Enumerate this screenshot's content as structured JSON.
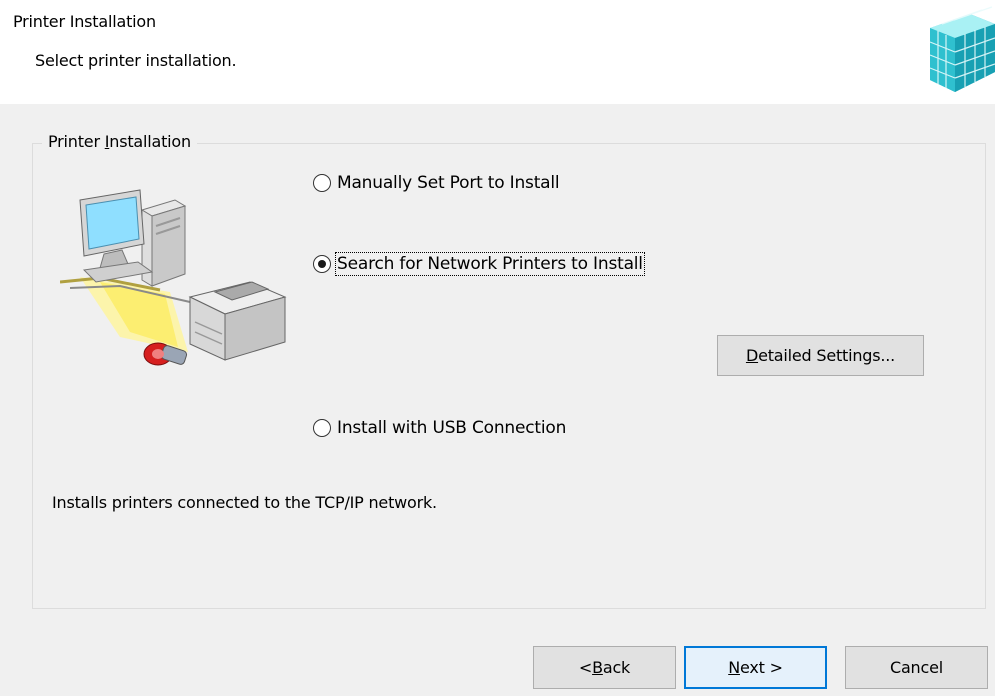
{
  "header": {
    "title": "Printer Installation",
    "subtitle": "Select printer installation."
  },
  "group": {
    "legend_pre": "Printer ",
    "legend_mnemonic": "I",
    "legend_post": "nstallation"
  },
  "options": {
    "manual": {
      "label": "Manually Set Port to Install",
      "selected": false
    },
    "network": {
      "label": "Search for Network Printers to Install",
      "selected": true
    },
    "usb": {
      "label": "Install with USB Connection",
      "selected": false
    }
  },
  "detailed_settings": {
    "mnemonic": "D",
    "rest": "etailed Settings..."
  },
  "description": "Installs printers connected to the TCP/IP network.",
  "buttons": {
    "back_pre": "< ",
    "back_mnemonic": "B",
    "back_post": "ack",
    "next_mnemonic": "N",
    "next_post": "ext >",
    "cancel": "Cancel"
  },
  "colors": {
    "accent": "#0078d7",
    "dialog_bg": "#f0f0f0"
  }
}
